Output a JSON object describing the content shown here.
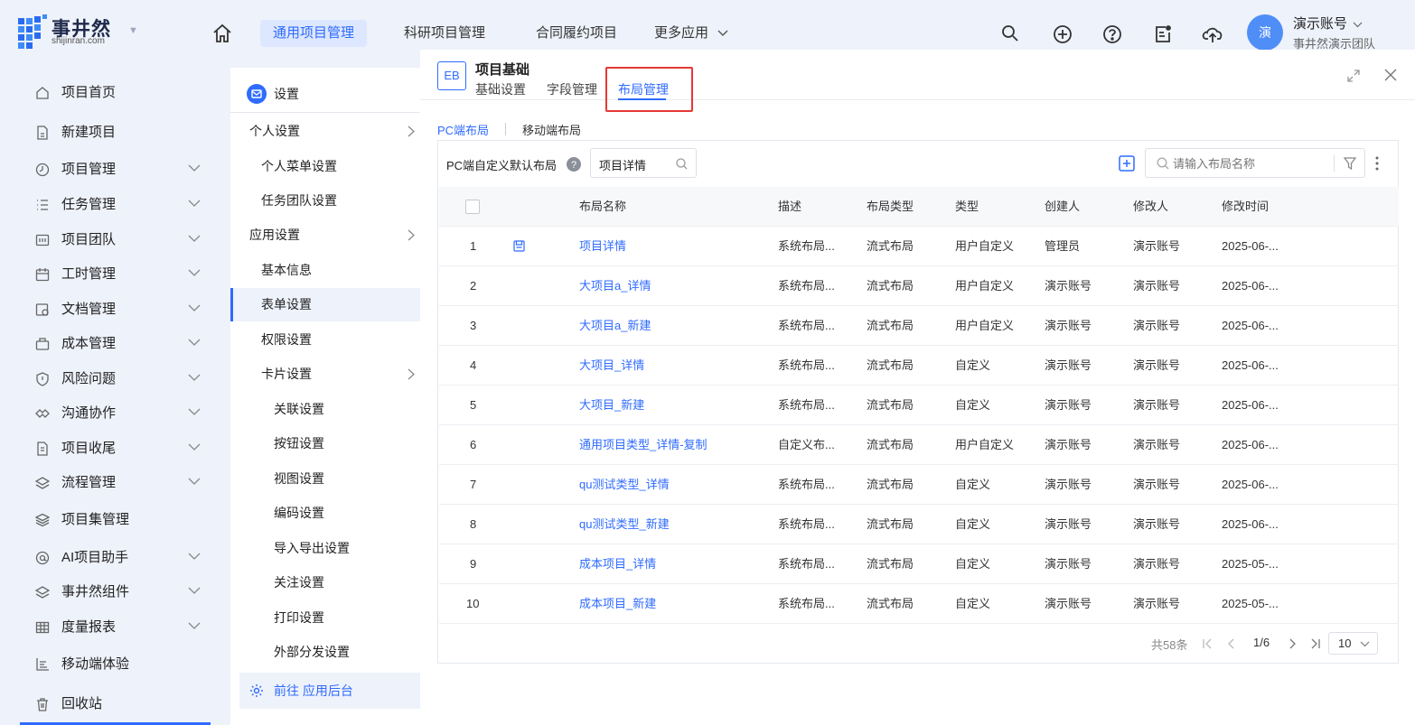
{
  "brand": {
    "name": "事井然",
    "sub": "shijinran.com"
  },
  "topnav": {
    "items": [
      {
        "label": "通用项目管理",
        "active": true
      },
      {
        "label": "科研项目管理",
        "active": false
      },
      {
        "label": "合同履约项目",
        "active": false
      },
      {
        "label": "更多应用",
        "active": false
      }
    ]
  },
  "user": {
    "avatar": "演",
    "name": "演示账号",
    "team": "事井然演示团队"
  },
  "sidebar": {
    "items": [
      {
        "label": "项目首页",
        "icon": "home-icon",
        "expand": false
      },
      {
        "label": "新建项目",
        "icon": "new-doc-icon",
        "expand": false
      },
      {
        "label": "项目管理",
        "icon": "clock-icon",
        "expand": true
      },
      {
        "label": "任务管理",
        "icon": "list-icon",
        "expand": true
      },
      {
        "label": "项目团队",
        "icon": "team-icon",
        "expand": true
      },
      {
        "label": "工时管理",
        "icon": "calendar-icon",
        "expand": true
      },
      {
        "label": "文档管理",
        "icon": "doc-icon",
        "expand": true
      },
      {
        "label": "成本管理",
        "icon": "bag-icon",
        "expand": true
      },
      {
        "label": "风险问题",
        "icon": "shield-icon",
        "expand": true
      },
      {
        "label": "沟通协作",
        "icon": "chat-icon",
        "expand": true
      },
      {
        "label": "项目收尾",
        "icon": "archive-icon",
        "expand": true
      },
      {
        "label": "流程管理",
        "icon": "layers-icon",
        "expand": true
      },
      {
        "label": "项目集管理",
        "icon": "stack-icon",
        "expand": false
      },
      {
        "label": "AI项目助手",
        "icon": "ai-icon",
        "expand": true
      },
      {
        "label": "事井然组件",
        "icon": "component-icon",
        "expand": true
      },
      {
        "label": "度量报表",
        "icon": "table-icon",
        "expand": true
      },
      {
        "label": "移动端体验",
        "icon": "chart-icon",
        "expand": false
      },
      {
        "label": "回收站",
        "icon": "trash-icon",
        "expand": false
      }
    ]
  },
  "settings": {
    "title": "设置",
    "items": [
      {
        "label": "个人设置",
        "level": 0,
        "arrow": true,
        "active": false
      },
      {
        "label": "个人菜单设置",
        "level": 1,
        "arrow": false,
        "active": false
      },
      {
        "label": "任务团队设置",
        "level": 1,
        "arrow": false,
        "active": false
      },
      {
        "label": "应用设置",
        "level": 0,
        "arrow": true,
        "active": false
      },
      {
        "label": "基本信息",
        "level": 1,
        "arrow": false,
        "active": false
      },
      {
        "label": "表单设置",
        "level": 1,
        "arrow": false,
        "active": true
      },
      {
        "label": "权限设置",
        "level": 1,
        "arrow": false,
        "active": false
      },
      {
        "label": "卡片设置",
        "level": 1,
        "arrow": true,
        "active": false
      },
      {
        "label": "关联设置",
        "level": 2,
        "arrow": false,
        "active": false
      },
      {
        "label": "按钮设置",
        "level": 2,
        "arrow": false,
        "active": false
      },
      {
        "label": "视图设置",
        "level": 2,
        "arrow": false,
        "active": false
      },
      {
        "label": "编码设置",
        "level": 2,
        "arrow": false,
        "active": false
      },
      {
        "label": "导入导出设置",
        "level": 2,
        "arrow": false,
        "active": false
      },
      {
        "label": "关注设置",
        "level": 2,
        "arrow": false,
        "active": false
      },
      {
        "label": "打印设置",
        "level": 2,
        "arrow": false,
        "active": false
      },
      {
        "label": "外部分发设置",
        "level": 2,
        "arrow": false,
        "active": false
      }
    ],
    "goto": "前往 应用后台"
  },
  "panel": {
    "badge": "EB",
    "title": "项目基础",
    "tabs": [
      {
        "label": "基础设置",
        "active": false
      },
      {
        "label": "字段管理",
        "active": false
      },
      {
        "label": "布局管理",
        "active": true
      }
    ],
    "subtabs": [
      {
        "label": "PC端布局",
        "active": true
      },
      {
        "label": "移动端布局",
        "active": false
      }
    ],
    "default_label": "PC端自定义默认布局",
    "default_value": "项目详情",
    "search_placeholder": "请输入布局名称",
    "columns": [
      "布局名称",
      "描述",
      "布局类型",
      "类型",
      "创建人",
      "修改人",
      "修改时间"
    ],
    "rows": [
      {
        "no": "1",
        "name": "项目详情",
        "desc": "系统布局...",
        "ltype": "流式布局",
        "type": "用户自定义",
        "creator": "管理员",
        "modifier": "演示账号",
        "time": "2025-06-...",
        "badge": true
      },
      {
        "no": "2",
        "name": "大项目a_详情",
        "desc": "系统布局...",
        "ltype": "流式布局",
        "type": "用户自定义",
        "creator": "演示账号",
        "modifier": "演示账号",
        "time": "2025-06-...",
        "badge": false
      },
      {
        "no": "3",
        "name": "大项目a_新建",
        "desc": "系统布局...",
        "ltype": "流式布局",
        "type": "用户自定义",
        "creator": "演示账号",
        "modifier": "演示账号",
        "time": "2025-06-...",
        "badge": false
      },
      {
        "no": "4",
        "name": "大项目_详情",
        "desc": "系统布局...",
        "ltype": "流式布局",
        "type": "自定义",
        "creator": "演示账号",
        "modifier": "演示账号",
        "time": "2025-06-...",
        "badge": false
      },
      {
        "no": "5",
        "name": "大项目_新建",
        "desc": "系统布局...",
        "ltype": "流式布局",
        "type": "自定义",
        "creator": "演示账号",
        "modifier": "演示账号",
        "time": "2025-06-...",
        "badge": false
      },
      {
        "no": "6",
        "name": "通用项目类型_详情-复制",
        "desc": "自定义布...",
        "ltype": "流式布局",
        "type": "用户自定义",
        "creator": "演示账号",
        "modifier": "演示账号",
        "time": "2025-06-...",
        "badge": false
      },
      {
        "no": "7",
        "name": "qu测试类型_详情",
        "desc": "系统布局...",
        "ltype": "流式布局",
        "type": "自定义",
        "creator": "演示账号",
        "modifier": "演示账号",
        "time": "2025-06-...",
        "badge": false
      },
      {
        "no": "8",
        "name": "qu测试类型_新建",
        "desc": "系统布局...",
        "ltype": "流式布局",
        "type": "自定义",
        "creator": "演示账号",
        "modifier": "演示账号",
        "time": "2025-06-...",
        "badge": false
      },
      {
        "no": "9",
        "name": "成本项目_详情",
        "desc": "系统布局...",
        "ltype": "流式布局",
        "type": "自定义",
        "creator": "演示账号",
        "modifier": "演示账号",
        "time": "2025-05-...",
        "badge": false
      },
      {
        "no": "10",
        "name": "成本项目_新建",
        "desc": "系统布局...",
        "ltype": "流式布局",
        "type": "自定义",
        "creator": "演示账号",
        "modifier": "演示账号",
        "time": "2025-05-...",
        "badge": false
      }
    ],
    "pagination": {
      "total": "共58条",
      "page": "1/6",
      "size": "10"
    }
  },
  "colors": {
    "accent": "#2f6bff",
    "highlight_box": "#e53935",
    "sidebar_bg": "#eef2fa"
  }
}
